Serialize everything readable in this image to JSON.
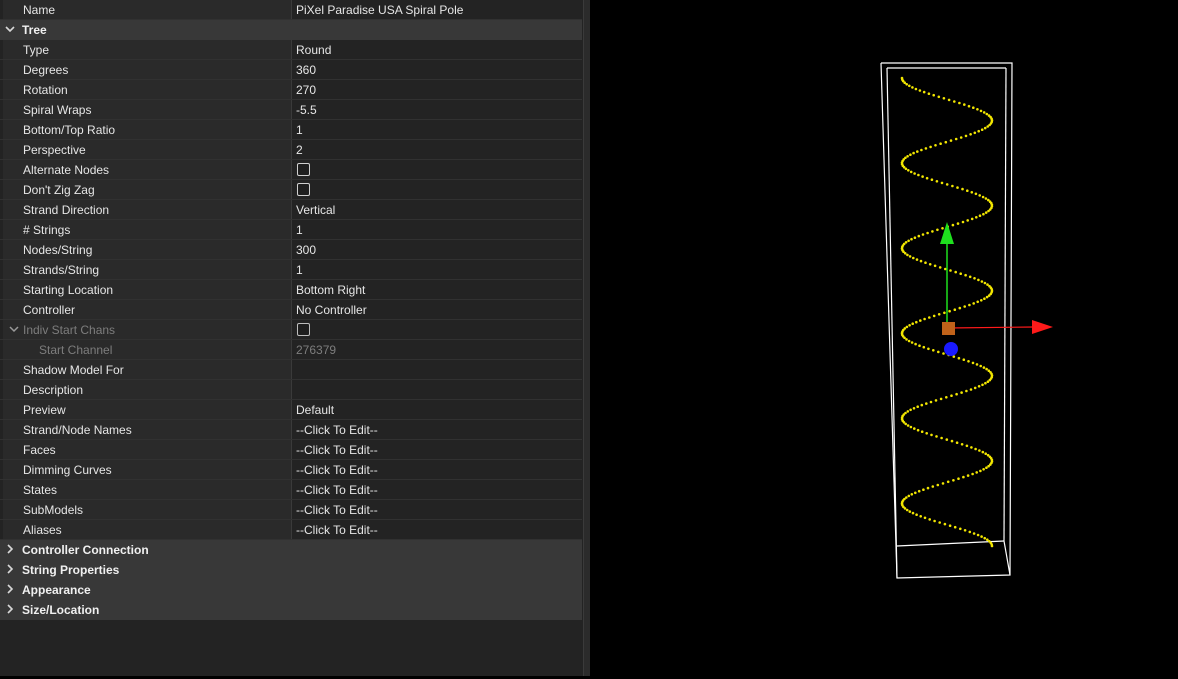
{
  "properties": {
    "name": {
      "label": "Name",
      "value": "PiXel Paradise USA Spiral Pole"
    },
    "tree_category": "Tree",
    "type": {
      "label": "Type",
      "value": "Round"
    },
    "degrees": {
      "label": "Degrees",
      "value": "360"
    },
    "rotation": {
      "label": "Rotation",
      "value": "270"
    },
    "spiral_wraps": {
      "label": "Spiral Wraps",
      "value": "-5.5"
    },
    "bottom_top_ratio": {
      "label": "Bottom/Top Ratio",
      "value": "1"
    },
    "perspective": {
      "label": "Perspective",
      "value": "2"
    },
    "alternate_nodes": {
      "label": "Alternate Nodes",
      "checked": false
    },
    "dont_zig_zag": {
      "label": "Don't Zig Zag",
      "checked": false
    },
    "strand_direction": {
      "label": "Strand Direction",
      "value": "Vertical"
    },
    "num_strings": {
      "label": "# Strings",
      "value": "1"
    },
    "nodes_string": {
      "label": "Nodes/String",
      "value": "300"
    },
    "strands_string": {
      "label": "Strands/String",
      "value": "1"
    },
    "starting_location": {
      "label": "Starting Location",
      "value": "Bottom Right"
    },
    "controller": {
      "label": "Controller",
      "value": "No Controller"
    },
    "indiv_start_chans": {
      "label": "Indiv Start Chans",
      "checked": false
    },
    "start_channel": {
      "label": "Start Channel",
      "value": "276379"
    },
    "shadow_model_for": {
      "label": "Shadow Model For",
      "value": ""
    },
    "description": {
      "label": "Description",
      "value": ""
    },
    "preview": {
      "label": "Preview",
      "value": "Default"
    },
    "strand_node_names": {
      "label": "Strand/Node Names",
      "value": "--Click To Edit--"
    },
    "faces": {
      "label": "Faces",
      "value": "--Click To Edit--"
    },
    "dimming_curves": {
      "label": "Dimming Curves",
      "value": "--Click To Edit--"
    },
    "states": {
      "label": "States",
      "value": "--Click To Edit--"
    },
    "submodels": {
      "label": "SubModels",
      "value": "--Click To Edit--"
    },
    "aliases": {
      "label": "Aliases",
      "value": "--Click To Edit--"
    },
    "controller_connection_category": "Controller Connection",
    "string_properties_category": "String Properties",
    "appearance_category": "Appearance",
    "size_location_category": "Size/Location"
  },
  "viewport": {
    "model_color": "#f2e600",
    "axis_colors": {
      "x": "#ff1a1a",
      "y": "#1ee01e",
      "z": "#1a1aff"
    },
    "handle_color": "#c0621a",
    "box_color": "#ffffff"
  }
}
